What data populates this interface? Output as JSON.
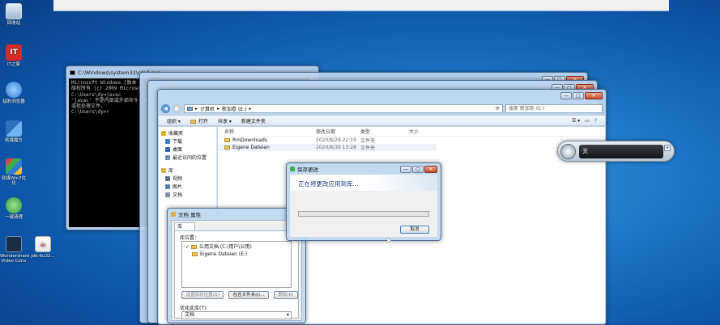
{
  "desktop": {
    "icons": [
      {
        "label": "回收站",
        "color": "#9fb6cf"
      },
      {
        "label": "IT之家",
        "color": "#d92a2a"
      },
      {
        "label": "猎豹浏览器",
        "color": "#2f7bd6"
      },
      {
        "label": "软媒魔方",
        "color": "#3b86d1"
      },
      {
        "label": "软媒Win7优化",
        "color": "#44a0e0"
      },
      {
        "label": "一键清理",
        "color": "#2f9a3e"
      },
      {
        "label": "Wondershare Video Conv",
        "color": "#1a2c46"
      },
      {
        "label": "jdk-6u32...",
        "color": "#d9534f"
      }
    ]
  },
  "cmd": {
    "title": "C:\\Windows\\system32\\cmd.exe",
    "lines": [
      "Microsoft Windows [版本 6.1.7601]",
      "版权所有 (c) 2009 Microsoft Corporation",
      "",
      "C:\\Users\\dy>javac",
      "'javac' 不是内部或外部命令，也不是可运行的程序",
      "或批处理文件。",
      "",
      "C:\\Users\\dy>r"
    ]
  },
  "explorer": {
    "address": [
      "计算机",
      "新加卷 (E:)"
    ],
    "search_placeholder": "搜索 新加卷 (E:)",
    "toolbar": [
      "组织 ▾",
      "打开",
      "共享 ▾",
      "新建文件夹"
    ],
    "nav": [
      {
        "label": "收藏夹",
        "color": "#e0b020"
      },
      {
        "label": "下载",
        "color": "#3c7fc8"
      },
      {
        "label": "桌面",
        "color": "#2d6bb0"
      },
      {
        "label": "最近访问的位置",
        "color": "#6a8fb8"
      },
      {
        "label": "",
        "color": ""
      },
      {
        "label": "库",
        "color": "#d9b04a"
      },
      {
        "label": "视频",
        "color": "#5a6f8a"
      },
      {
        "label": "图片",
        "color": "#4f86b8"
      },
      {
        "label": "文档",
        "color": "#7a90aa"
      }
    ],
    "columns": [
      "名称",
      "修改日期",
      "类型",
      "大小"
    ],
    "files": [
      {
        "name": "RmDownloads",
        "date": "2020/8/29 22:19",
        "type": "文件夹"
      },
      {
        "name": "Eigene Dateien",
        "date": "2020/8/30 13:28",
        "type": "文件夹"
      }
    ]
  },
  "properties": {
    "title": "文档 属性",
    "tab": "库",
    "section_label": "库位置：",
    "locations": [
      "公用文档 (C:\\用户\\公用)",
      "Eigene Dateien (E:)"
    ],
    "buttons": [
      "设置保存位置(S)",
      "包含文件夹(I)...",
      "删除(R)"
    ],
    "optimize_label": "优化此库(T):",
    "optimize_value": "文档"
  },
  "save_dialog": {
    "title": "保存更改",
    "message": "正在将更改应用到库...",
    "cancel": "取消",
    "progress": 0.0
  },
  "volume": {
    "label": "关"
  },
  "window_controls": {
    "minimize": "—",
    "maximize": "□",
    "close": "✕"
  }
}
